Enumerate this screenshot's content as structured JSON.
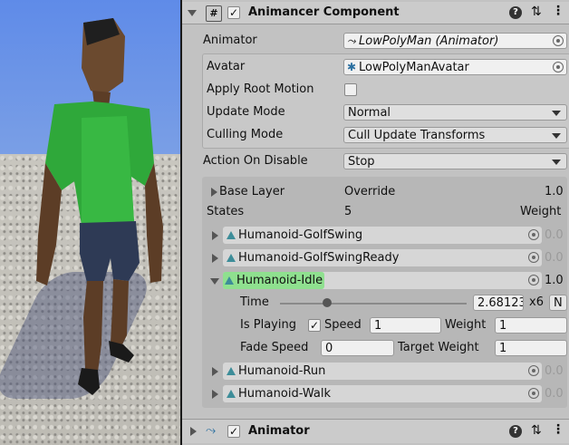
{
  "component": {
    "title": "Animancer Component",
    "animator_label": "Animator",
    "animator_value": "LowPolyMan (Animator)",
    "avatar_label": "Avatar",
    "avatar_value": "LowPolyManAvatar",
    "apply_root_motion_label": "Apply Root Motion",
    "update_mode_label": "Update Mode",
    "update_mode_value": "Normal",
    "culling_mode_label": "Culling Mode",
    "culling_mode_value": "Cull Update Transforms",
    "action_on_disable_label": "Action On Disable",
    "action_on_disable_value": "Stop"
  },
  "layer": {
    "name": "Base Layer",
    "blend": "Override",
    "weight": "1.0",
    "states_label": "States",
    "states_count": "5",
    "weight_header": "Weight"
  },
  "states": [
    {
      "name": "Humanoid-GolfSwing",
      "weight": "0.0"
    },
    {
      "name": "Humanoid-GolfSwingReady",
      "weight": "0.0"
    },
    {
      "name": "Humanoid-Idle",
      "weight": "1.0"
    },
    {
      "name": "Humanoid-Run",
      "weight": "0.0"
    },
    {
      "name": "Humanoid-Walk",
      "weight": "0.0"
    }
  ],
  "idle_details": {
    "time_label": "Time",
    "time_value": "2.68123",
    "multiplier": "x6",
    "n_button": "N",
    "time_fraction": 0.25,
    "is_playing_label": "Is Playing",
    "speed_label": "Speed",
    "speed_value": "1",
    "weight_label": "Weight",
    "weight_value": "1",
    "fade_speed_label": "Fade Speed",
    "fade_speed_value": "0",
    "target_weight_label": "Target Weight",
    "target_weight_value": "1"
  },
  "animator_component": {
    "title": "Animator"
  },
  "icons": {
    "script": "script-icon",
    "help": "help-icon",
    "settings": "settings-icon",
    "menu": "menu-icon"
  },
  "colors": {
    "idle_highlight": "#8fe08f",
    "anim_icon": "#3d8d99"
  }
}
